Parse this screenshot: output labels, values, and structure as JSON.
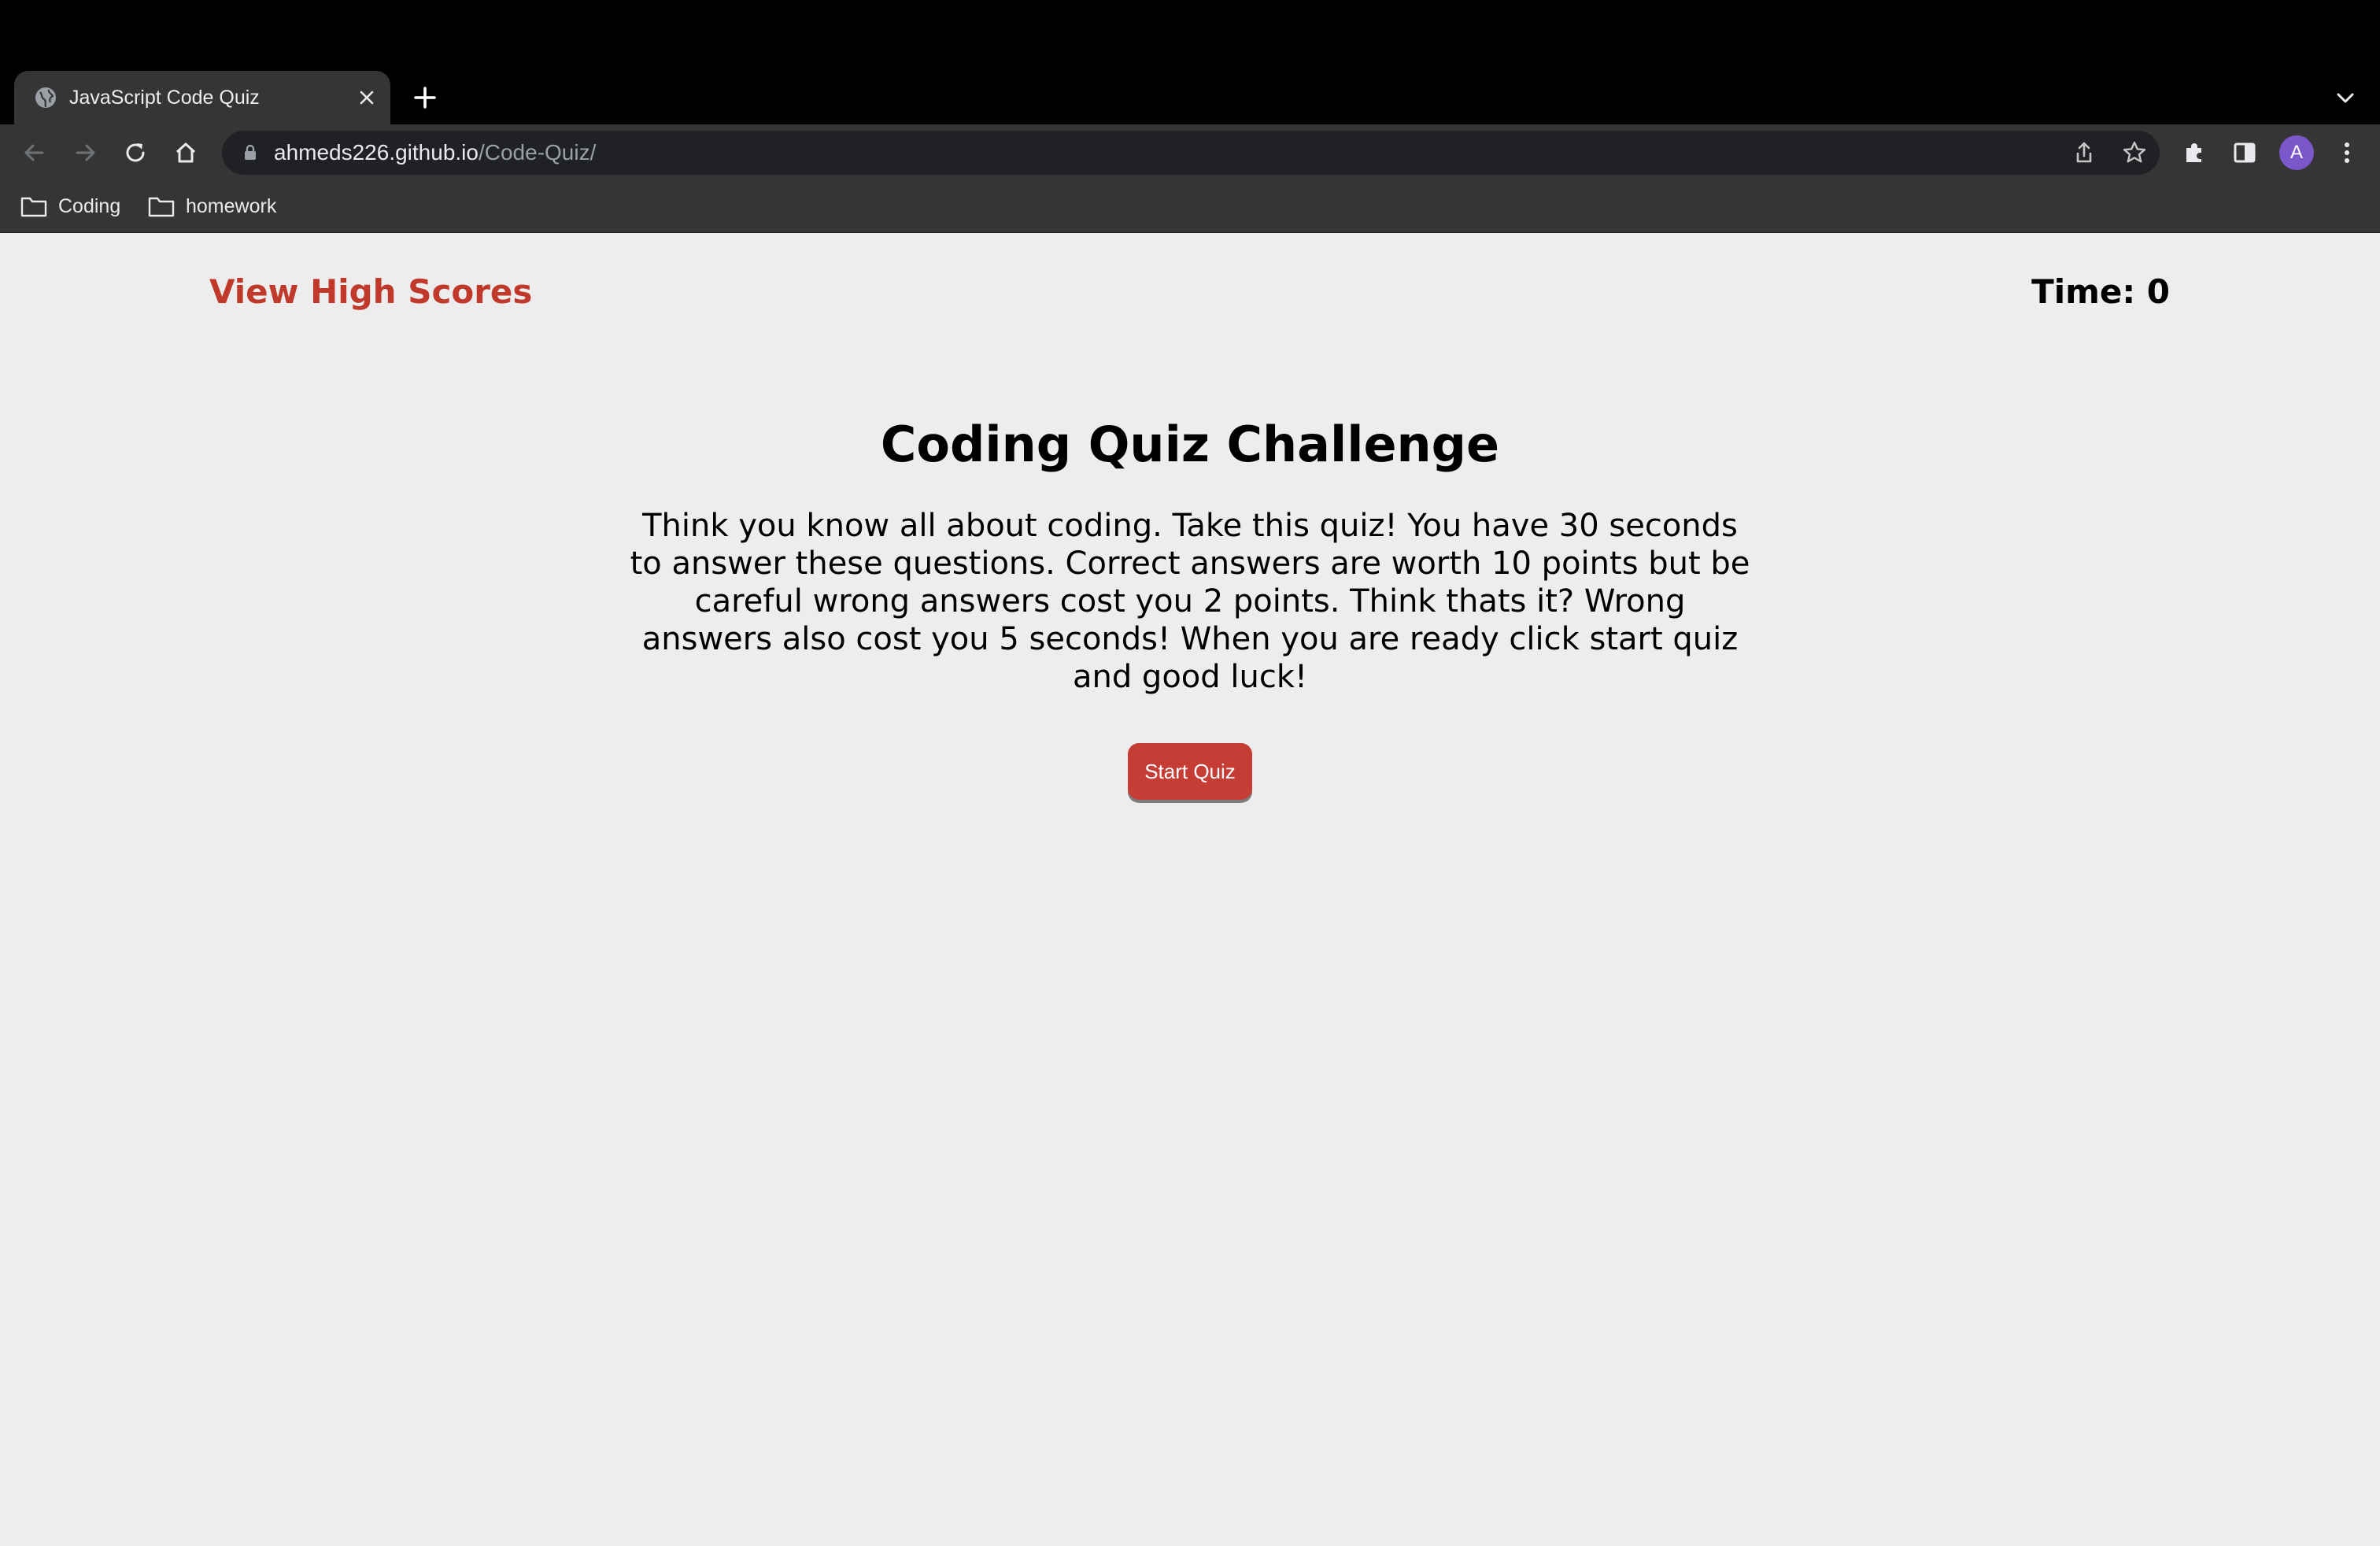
{
  "browser": {
    "tab": {
      "title": "JavaScript Code Quiz",
      "favicon": "globe-icon"
    },
    "address_bar": {
      "host": "ahmeds226.github.io",
      "path": "/Code-Quiz/"
    },
    "profile_initial": "A",
    "bookmarks": [
      {
        "label": "Coding",
        "icon": "folder-icon"
      },
      {
        "label": "homework",
        "icon": "folder-icon"
      }
    ]
  },
  "page": {
    "highscores_link": "View High Scores",
    "timer_label": "Time: 0",
    "title": "Coding Quiz Challenge",
    "intro": "Think you know all about coding. Take this quiz! You have 30 seconds to answer these questions. Correct answers are worth 10 points but be careful wrong answers cost you 2 points. Think thats it? Wrong answers also cost you 5 seconds! When you are ready click start quiz and good luck!",
    "start_button": "Start Quiz"
  },
  "colors": {
    "accent": "#c0392b",
    "button": "#c63d36",
    "page_background": "#ededed"
  }
}
